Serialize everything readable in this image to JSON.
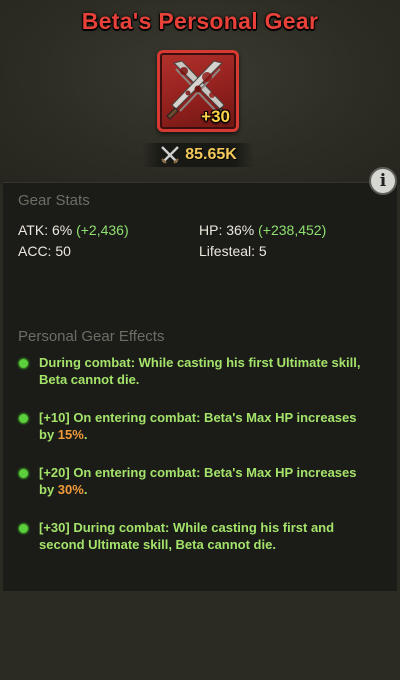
{
  "title": "Beta's Personal Gear",
  "gear": {
    "level": "+30",
    "icon": "crossed-blades-icon"
  },
  "power": {
    "value": "85.65K",
    "icon": "crossed-swords-icon"
  },
  "stats_section": {
    "title": "Gear Stats",
    "atk": {
      "label": "ATK: 6%",
      "bonus": "(+2,436)"
    },
    "hp": {
      "label": "HP: 36%",
      "bonus": "(+238,452)"
    },
    "acc": {
      "label": "ACC: 50"
    },
    "lifesteal": {
      "label": "Lifesteal: 5"
    }
  },
  "effects_section": {
    "title": "Personal Gear Effects",
    "effects": [
      {
        "text": "During combat: While casting his first Ultimate skill, Beta cannot die."
      },
      {
        "pre": "[+10] On entering combat: Beta's Max HP increases by ",
        "highlight": "15%",
        "post": "."
      },
      {
        "pre": "[+20] On entering combat: Beta's Max HP increases by ",
        "highlight": "30%",
        "post": "."
      },
      {
        "text": "[+30] During combat: While casting his first and second Ultimate skill, Beta cannot die."
      }
    ]
  },
  "colors": {
    "title": "#e8413a",
    "bonus": "#8fe070",
    "effect_text": "#a4e36a",
    "highlight": "#f29b3b",
    "level_badge": "#ffd24a",
    "power": "#f2c85a"
  }
}
